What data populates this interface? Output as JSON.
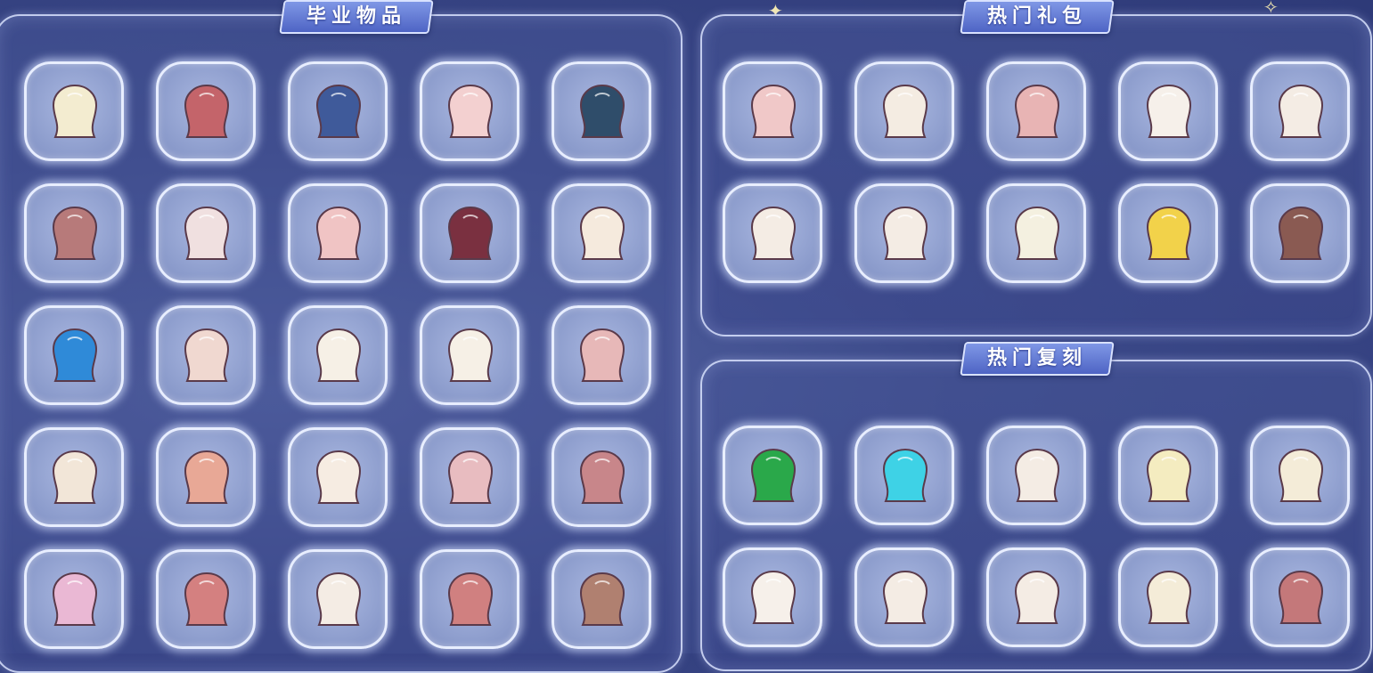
{
  "sections": {
    "graduation": {
      "title": "毕业物品"
    },
    "gift_packs": {
      "title": "热门礼包"
    },
    "reruns": {
      "title": "热门复刻"
    }
  },
  "graduation_items": [
    {
      "name": "cream-hair-icon",
      "color": "#f3ecd0"
    },
    {
      "name": "horned-mask-icon",
      "color": "#c4646a"
    },
    {
      "name": "blue-cape-icon",
      "color": "#3f5a9a"
    },
    {
      "name": "pink-cape-icon",
      "color": "#f3d0d0"
    },
    {
      "name": "dark-layered-cape-icon",
      "color": "#2f4d6a"
    },
    {
      "name": "pink-necklace-icon",
      "color": "#b77a7a"
    },
    {
      "name": "diamond-prop-icon",
      "color": "#f0e0e0"
    },
    {
      "name": "pink-shell-cape-icon",
      "color": "#f0c4c4"
    },
    {
      "name": "maroon-fur-cape-icon",
      "color": "#7a3040"
    },
    {
      "name": "piano-icon",
      "color": "#f5eadd"
    },
    {
      "name": "blue-ruffle-cape-icon",
      "color": "#2f8ad8"
    },
    {
      "name": "picture-frame-icon",
      "color": "#f0d8d0"
    },
    {
      "name": "moomin-plush-icon",
      "color": "#f6f0e6"
    },
    {
      "name": "music-umbrella-icon",
      "color": "#f6f0e6"
    },
    {
      "name": "pink-coat-outfit-icon",
      "color": "#e7b8b8"
    },
    {
      "name": "antler-mask-icon",
      "color": "#f2e6d8"
    },
    {
      "name": "long-scarf-icon",
      "color": "#e8a896"
    },
    {
      "name": "winged-headdress-icon",
      "color": "#f6ece2"
    },
    {
      "name": "tiered-cape-icon",
      "color": "#e8bcc0"
    },
    {
      "name": "diamond-headpiece-icon",
      "color": "#c8868a"
    },
    {
      "name": "lilac-cape-icon",
      "color": "#eab8d4"
    },
    {
      "name": "winged-necklace-icon",
      "color": "#d48080"
    },
    {
      "name": "white-boot-icon",
      "color": "#f4ece4"
    },
    {
      "name": "tiny-outfit-icon",
      "color": "#d08080"
    },
    {
      "name": "stone-mask-icon",
      "color": "#b08070"
    }
  ],
  "gift_pack_items": [
    {
      "name": "pink-outfit-icon",
      "color": "#f0c8c8"
    },
    {
      "name": "white-robe-outfit-icon",
      "color": "#f4ece2"
    },
    {
      "name": "pink-gown-outfit-icon",
      "color": "#e8b4b4"
    },
    {
      "name": "white-dress-icon",
      "color": "#f6f0ea"
    },
    {
      "name": "hair-bun-icon",
      "color": "#f4ece4"
    },
    {
      "name": "sneaker-shoe-icon",
      "color": "#f4ece4"
    },
    {
      "name": "fur-boot-icon",
      "color": "#f4ece4"
    },
    {
      "name": "fluffy-hat-icon",
      "color": "#f4f0e0"
    },
    {
      "name": "yellow-cape-icon",
      "color": "#f2d24a"
    },
    {
      "name": "brown-mask-icon",
      "color": "#8a5a52"
    }
  ],
  "rerun_items": [
    {
      "name": "green-leaf-cape-icon",
      "color": "#2aa84a"
    },
    {
      "name": "cyan-cloud-cape-icon",
      "color": "#3ed2e6"
    },
    {
      "name": "white-pants-icon",
      "color": "#f4ece4"
    },
    {
      "name": "blonde-short-hair-icon",
      "color": "#f4ecc0"
    },
    {
      "name": "wavy-long-hair-icon",
      "color": "#f4ecd8"
    },
    {
      "name": "cat-ear-hood-icon",
      "color": "#f6f0ea"
    },
    {
      "name": "white-jumpsuit-icon",
      "color": "#f4ece4"
    },
    {
      "name": "cargo-pants-icon",
      "color": "#f4ece4"
    },
    {
      "name": "flower-crown-hair-icon",
      "color": "#f4ecd8"
    },
    {
      "name": "earmuffs-icon",
      "color": "#c4787a"
    }
  ]
}
